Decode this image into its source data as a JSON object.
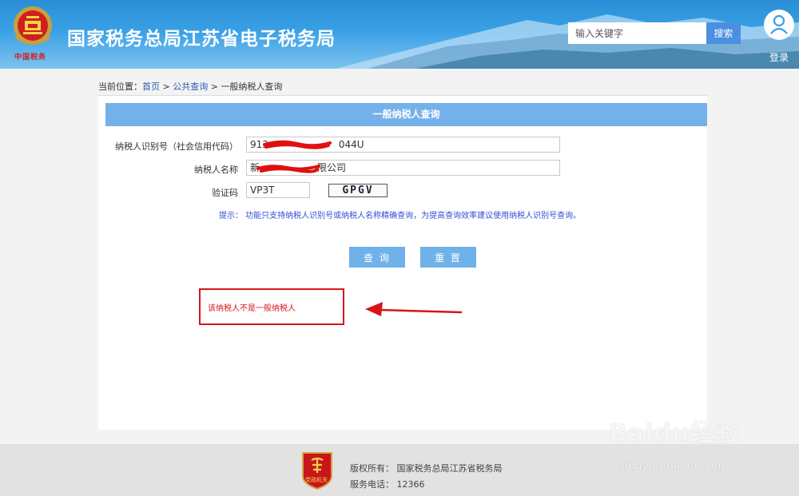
{
  "header": {
    "site_title": "国家税务总局江苏省电子税务局",
    "emblem_caption": "中国税务",
    "search_placeholder": "输入关键字",
    "search_button": "搜索",
    "login_label": "登录"
  },
  "breadcrumb": {
    "prefix": "当前位置：",
    "home": "首页",
    "sep": " > ",
    "public_query": "公共查询",
    "current": "一般纳税人查询"
  },
  "panel": {
    "title": "一般纳税人查询",
    "fields": {
      "taxpayer_id_label": "纳税人识别号（社会信用代码）",
      "taxpayer_id_value_visible_start": "913",
      "taxpayer_id_value_visible_end": "044U",
      "taxpayer_name_label": "纳税人名称",
      "taxpayer_name_value_visible_start": "新",
      "taxpayer_name_value_visible_end": "限公司",
      "captcha_label": "验证码",
      "captcha_value": "VP3T",
      "captcha_image_text": "GPGV"
    },
    "hint": "提示：  功能只支持纳税人识别号或纳税人名称精确查询，为提高查询效率建议使用纳税人识别号查询。",
    "query_button": "查 询",
    "reset_button": "重 置",
    "result_message": "该纳税人不是一般纳税人"
  },
  "footer": {
    "emblem_caption": "党政机关",
    "copyright": "版权所有：  国家税务总局江苏省税务局",
    "phone": "服务电话：  12366"
  },
  "watermark": {
    "logo": "Baidu经验",
    "url": "jingyan.baidu.com"
  },
  "colors": {
    "header_blue": "#2a8fd6",
    "panel_head": "#74b1ea",
    "button": "#6fb2ea",
    "alert_red": "#d8141b",
    "hint_blue": "#2f4fd6"
  }
}
